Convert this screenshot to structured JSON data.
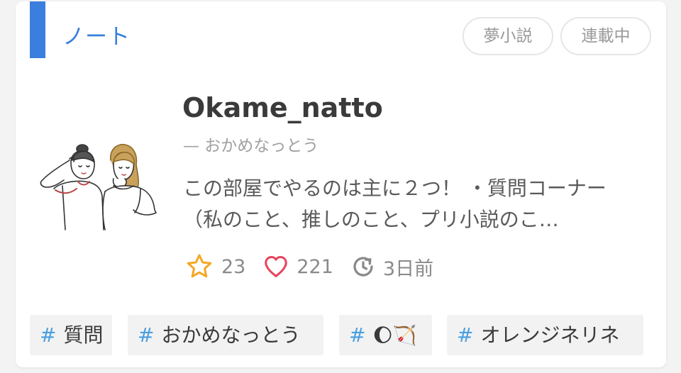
{
  "card": {
    "category": "ノート",
    "genre_pill": "夢小説",
    "status_pill": "連載中"
  },
  "author": {
    "name": "Okame_natto",
    "sub": "— おかめなっとう",
    "avatar_icon": "two-girls-illustration"
  },
  "description": "この部屋でやるのは主に２つ！ ・質問コーナー （私のこと、推しのこと、プリ小説のこ…",
  "stats": {
    "stars": "23",
    "hearts": "221",
    "updated": "3日前",
    "star_icon": "star-outline-icon",
    "heart_icon": "heart-outline-icon",
    "clock_icon": "history-clock-icon"
  },
  "tags": [
    {
      "hash": "#",
      "label": "質問"
    },
    {
      "hash": "#",
      "label": "おかめなっとう"
    },
    {
      "hash": "#",
      "label": "🌔🏹"
    },
    {
      "hash": "#",
      "label": "オレンジネリネ"
    }
  ],
  "colors": {
    "accent": "#3b7fde",
    "star": "#f5a623",
    "heart": "#e8435a",
    "hash": "#4a9fe0"
  }
}
